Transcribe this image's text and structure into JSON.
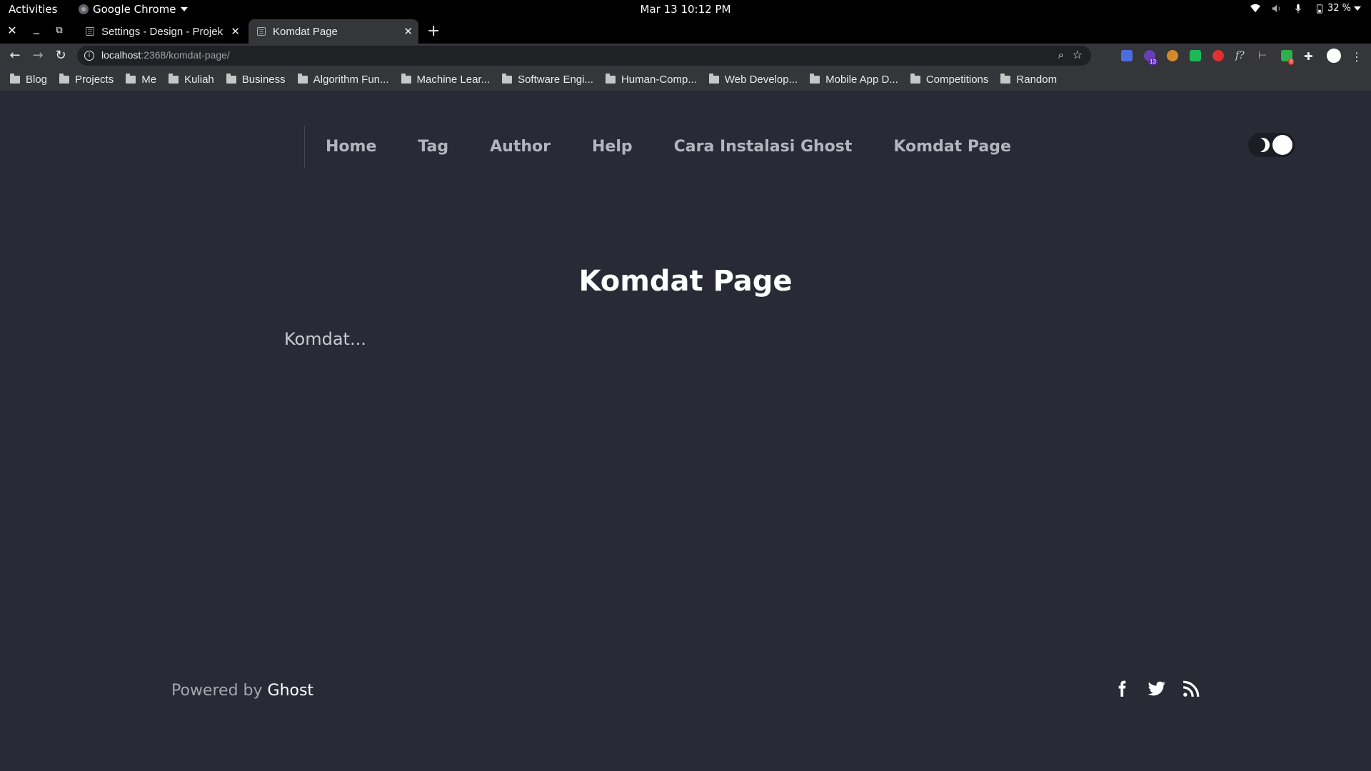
{
  "system_bar": {
    "activities": "Activities",
    "app_name": "Google Chrome",
    "clock": "Mar 13  10:12 PM",
    "battery": "32 %"
  },
  "browser": {
    "tabs": [
      {
        "title": "Settings - Design - Projek",
        "favicon": "ghost-favicon-icon",
        "active": false
      },
      {
        "title": "Komdat Page",
        "favicon": "ghost-favicon-icon",
        "active": true
      }
    ],
    "url": {
      "host": "localhost",
      "path": ":2368/komdat-page/"
    },
    "bookmarks": [
      "Blog",
      "Projects",
      "Me",
      "Kuliah",
      "Business",
      "Algorithm Fun...",
      "Machine Lear...",
      "Software Engi...",
      "Human-Comp...",
      "Web Develop...",
      "Mobile App D...",
      "Competitions",
      "Random"
    ],
    "extension_badges": {
      "first": "13",
      "second": "8"
    }
  },
  "site": {
    "nav": [
      "Home",
      "Tag",
      "Author",
      "Help",
      "Cara Instalasi Ghost",
      "Komdat Page"
    ],
    "title": "Komdat Page",
    "content": "Komdat...",
    "footer": {
      "prefix": "Powered by ",
      "brand": "Ghost"
    },
    "social": [
      "facebook-icon",
      "twitter-icon",
      "rss-icon"
    ],
    "colors": {
      "background": "#292a36",
      "nav_text": "#b3b4bd",
      "title": "#ffffff"
    }
  }
}
